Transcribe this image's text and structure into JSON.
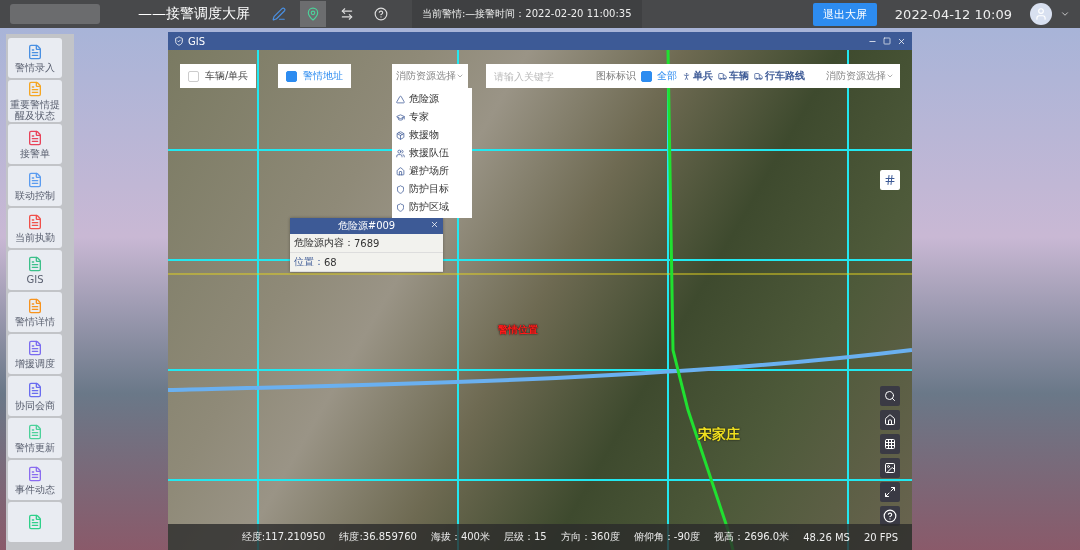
{
  "topbar": {
    "title": "——接警调度大屏",
    "tools": [
      {
        "kind": "pen",
        "selected": false
      },
      {
        "kind": "gis",
        "selected": true
      },
      {
        "kind": "swap",
        "selected": false
      },
      {
        "kind": "help",
        "selected": false
      }
    ],
    "alarm": "当前警情:—接警时间：2022-02-20 11:00:35",
    "exit_button": "退出大屏",
    "clock": "2022-04-12 10:09"
  },
  "sidebar": [
    {
      "label": "警情录入",
      "color": "#4a90e2"
    },
    {
      "label": "重要警情提醒及状态",
      "color": "#f5a623"
    },
    {
      "label": "接警单",
      "color": "#e8435a"
    },
    {
      "label": "联动控制",
      "color": "#5b9cf0"
    },
    {
      "label": "当前执勤",
      "color": "#f0504a"
    },
    {
      "label": "GIS",
      "color": "#3cc08a"
    },
    {
      "label": "警情详情",
      "color": "#f7931e"
    },
    {
      "label": "增援调度",
      "color": "#7b6cf0"
    },
    {
      "label": "协同会商",
      "color": "#6a6cf0"
    },
    {
      "label": "警情更新",
      "color": "#4cd19a"
    },
    {
      "label": "事件动态",
      "color": "#8a6cf0"
    },
    {
      "color": "#2fd08a"
    }
  ],
  "window": {
    "title": "GIS",
    "filters": [
      {
        "label": "车辆/单兵",
        "checked": false
      },
      {
        "label": "警情地址",
        "checked": true
      }
    ],
    "resource_select": "消防资源选择",
    "resource_menu": [
      {
        "label": "危险源",
        "kind": "hazard"
      },
      {
        "label": "专家",
        "kind": "expert"
      },
      {
        "label": "救援物",
        "kind": "supply"
      },
      {
        "label": "救援队伍",
        "kind": "team"
      },
      {
        "label": "避护场所",
        "kind": "shelter"
      },
      {
        "label": "防护目标",
        "kind": "shield"
      },
      {
        "label": "防护区域",
        "kind": "shield"
      }
    ],
    "search": {
      "placeholder": "请输入关键字"
    },
    "legend": {
      "title": "图标标识",
      "all": {
        "label": "全部",
        "checked": true
      },
      "items": [
        {
          "label": "单兵",
          "kind": "person"
        },
        {
          "label": "车辆",
          "kind": "truck"
        },
        {
          "label": "行车路线",
          "kind": "truck"
        }
      ],
      "select": "消防资源选择"
    },
    "popup": {
      "title": "危险源#009",
      "rows": [
        {
          "label": "危险源内容：",
          "value": "7689"
        },
        {
          "label": "位置：",
          "value": "68"
        }
      ]
    },
    "map_labels": [
      {
        "text": "警情位置",
        "kind": "incident"
      },
      {
        "text": "宋家庄",
        "kind": "village"
      }
    ],
    "status_bar": [
      "经度:117.210950",
      "纬度:36.859760",
      "海拔：400米",
      "层级：15",
      "方向：360度",
      "俯仰角：-90度",
      "视高：2696.0米",
      "48.26 MS",
      "20 FPS"
    ]
  }
}
